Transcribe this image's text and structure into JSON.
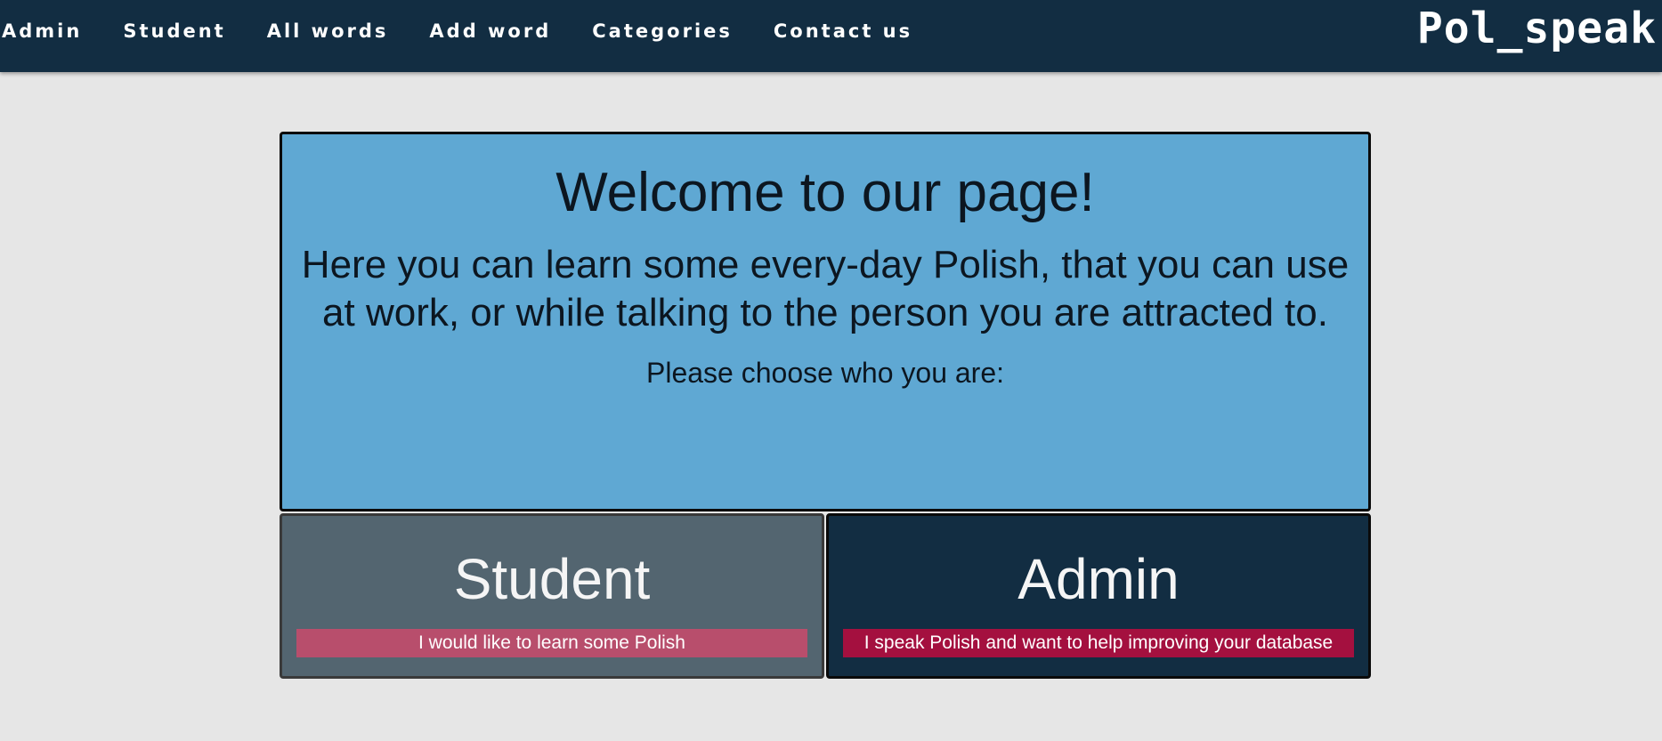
{
  "nav": {
    "items": [
      {
        "label": "Admin"
      },
      {
        "label": "Student"
      },
      {
        "label": "All words"
      },
      {
        "label": "Add word"
      },
      {
        "label": "Categories"
      },
      {
        "label": "Contact us"
      }
    ],
    "brand": "Pol_speak"
  },
  "welcome": {
    "title": "Welcome to our page!",
    "intro": "Here you can learn some every-day Polish, that you can use at work, or while talking to the person you are attracted to.",
    "prompt": "Please choose who you are:"
  },
  "roles": {
    "student": {
      "title": "Student",
      "description": "I would like to learn some Polish"
    },
    "admin": {
      "title": "Admin",
      "description": "I speak Polish and want to help improving your database"
    }
  },
  "colors": {
    "nav_background": "#122d42",
    "page_background": "#e6e6e6",
    "welcome_background": "#5fa8d3",
    "student_card": "#536570",
    "admin_card": "#122d42",
    "student_badge": "#b84e6c",
    "admin_badge": "#a4103f"
  }
}
